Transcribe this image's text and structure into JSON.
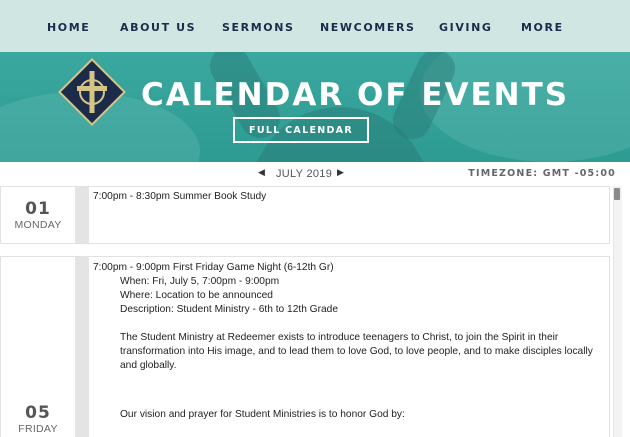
{
  "nav": {
    "items": [
      "HOME",
      "ABOUT US",
      "SERMONS",
      "NEWCOMERS",
      "GIVING",
      "MORE"
    ]
  },
  "hero": {
    "title": "CALENDAR OF EVENTS",
    "button_label": "FULL CALENDAR"
  },
  "calendar": {
    "prev_icon": "◀",
    "month": "JULY 2019",
    "next_icon": "▶",
    "timezone": "TIMEZONE: GMT -05:00"
  },
  "days": [
    {
      "num": "01",
      "name": "MONDAY",
      "events": [
        "7:00pm - 8:30pm Summer Book Study"
      ]
    },
    {
      "num": "05",
      "name": "FRIDAY",
      "event_title": "7:00pm - 9:00pm First Friday Game Night (6-12th Gr)",
      "when": "When: Fri, July 5, 7:00pm - 9:00pm",
      "where": "Where: Location to be announced",
      "description": "Description: Student Ministry - 6th to 12th Grade",
      "para1": "The Student Ministry at Redeemer exists to introduce teenagers to Christ, to join the Spirit in their transformation into His image, and to lead them to love God, to love people, and to make disciples locally and globally.",
      "para2": "Our vision and prayer for Student Ministries is to honor God by:"
    }
  ],
  "colors": {
    "nav_bg": "#cfe6e3",
    "hero_bg": "#3aa89f",
    "nav_text": "#1c2b4a"
  },
  "icons": [
    "cross-logo-icon",
    "chevron-left-icon",
    "chevron-right-icon"
  ]
}
